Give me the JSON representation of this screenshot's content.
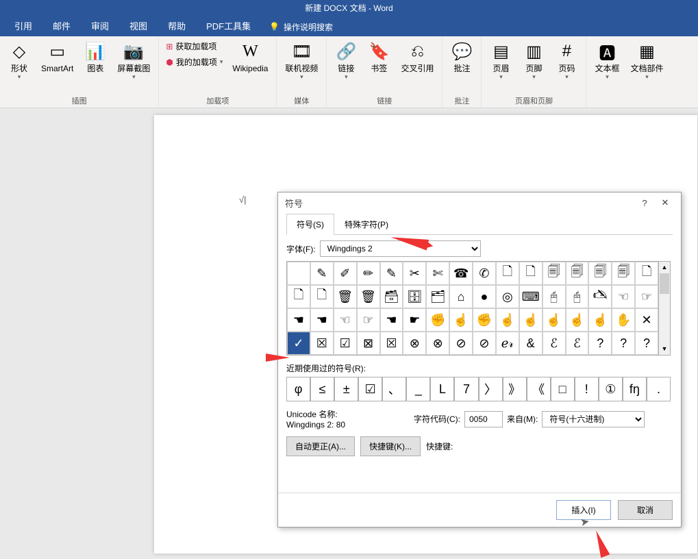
{
  "titlebar": {
    "title": "新建 DOCX 文档 - Word"
  },
  "tabs": [
    "引用",
    "邮件",
    "审阅",
    "视图",
    "帮助",
    "PDF工具集"
  ],
  "tell_me": "操作说明搜索",
  "ribbon": {
    "groups": {
      "插图": {
        "label": "插图",
        "items": {
          "shapes": "形状",
          "smartart": "SmartArt",
          "chart": "图表",
          "screenshot": "屏幕截图"
        }
      },
      "加载项": {
        "label": "加载项",
        "items": {
          "get": "获取加载项",
          "my": "我的加载项",
          "wiki": "Wikipedia"
        }
      },
      "媒体": {
        "label": "媒体",
        "items": {
          "video": "联机视频"
        }
      },
      "链接": {
        "label": "链接",
        "items": {
          "link": "链接",
          "bookmark": "书签",
          "xref": "交叉引用"
        }
      },
      "批注": {
        "label": "批注",
        "items": {
          "comment": "批注"
        }
      },
      "页眉和页脚": {
        "label": "页眉和页脚",
        "items": {
          "header": "页眉",
          "footer": "页脚",
          "pagenum": "页码"
        }
      },
      "文本": {
        "label": "",
        "items": {
          "textbox": "文本框",
          "parts": "文档部件"
        }
      }
    }
  },
  "doc_cursor": "√|",
  "dialog": {
    "title": "符号",
    "help": "?",
    "close": "✕",
    "tab_symbols": "符号(S)",
    "tab_special": "特殊字符(P)",
    "font_label": "字体(F):",
    "font_value": "Wingdings 2",
    "symbol_rows": [
      [
        "",
        "✎",
        "✐",
        "✏",
        "✎",
        "✂",
        "✄",
        "☎",
        "✆",
        "🗋",
        "🗋",
        "🗐",
        "🗐",
        "🗐",
        "🗐",
        "🗋"
      ],
      [
        "🗋",
        "🗋",
        "🗑",
        "🗑",
        "🗃",
        "🗄",
        "🗂",
        "⌂",
        "●",
        "◎",
        "⌨",
        "🖰",
        "🖰",
        "🖎",
        "☜",
        "☞"
      ],
      [
        "☚",
        "☚",
        "☜",
        "☞",
        "☚",
        "☛",
        "✊",
        "☝",
        "✊",
        "☝",
        "☝",
        "☝",
        "☝",
        "☝",
        "✋",
        "✕"
      ],
      [
        "✓",
        "☒",
        "☑",
        "⊠",
        "☒",
        "⊗",
        "⊗",
        "⊘",
        "⊘",
        "ℯ𝓇",
        "&",
        "ℰ",
        "ℰ",
        "?",
        "?",
        "?"
      ]
    ],
    "selected_index": 48,
    "recent_label": "近期使用过的符号(R):",
    "recent": [
      "φ",
      "≤",
      "±",
      "☑",
      "、",
      "_",
      "L",
      "7",
      "〉",
      "》",
      "《",
      "□",
      "!",
      "①",
      "fŋ",
      "."
    ],
    "unicode_name_label": "Unicode 名称:",
    "unicode_value": "Wingdings 2: 80",
    "charcode_label": "字符代码(C):",
    "charcode_value": "0050",
    "from_label": "来自(M):",
    "from_value": "符号(十六进制)",
    "autocorrect": "自动更正(A)...",
    "shortcut": "快捷键(K)...",
    "shortcut_label": "快捷键:",
    "insert": "插入(I)",
    "cancel": "取消"
  }
}
